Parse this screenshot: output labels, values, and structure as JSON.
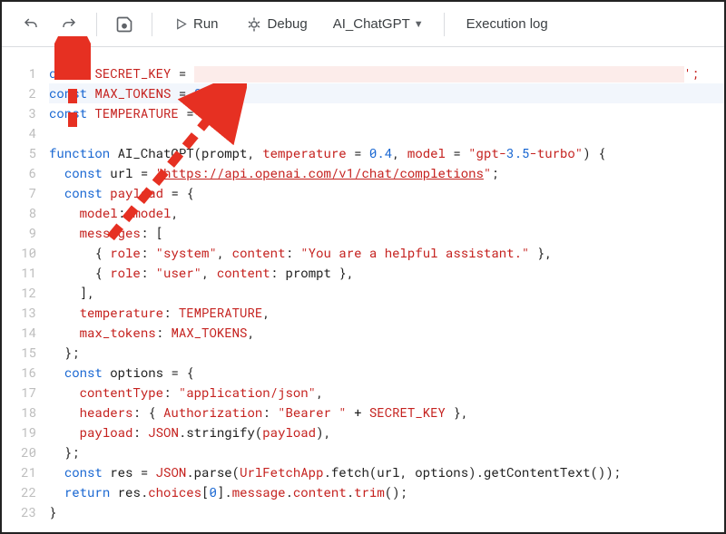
{
  "toolbar": {
    "undo_title": "Undo",
    "redo_title": "Redo",
    "save_title": "Save",
    "run_label": "Run",
    "debug_label": "Debug",
    "function_selected": "AI_ChatGPT",
    "execution_log_label": "Execution log"
  },
  "editor": {
    "current_line": 2,
    "lines": [
      "const SECRET_KEY = ",
      "const MAX_TOKENS = 800;",
      "const TEMPERATURE = 0.9;",
      "",
      "function AI_ChatGPT(prompt, temperature = 0.4, model = \"gpt-3.5-turbo\") {",
      "  const url = \"https://api.openai.com/v1/chat/completions\";",
      "  const payload = {",
      "    model: model,",
      "    messages: [",
      "      { role: \"system\", content: \"You are a helpful assistant.\" },",
      "      { role: \"user\", content: prompt },",
      "    ],",
      "    temperature: TEMPERATURE,",
      "    max_tokens: MAX_TOKENS,",
      "  };",
      "  const options = {",
      "    contentType: \"application/json\",",
      "    headers: { Authorization: \"Bearer \" + SECRET_KEY },",
      "    payload: JSON.stringify(payload),",
      "  };",
      "  const res = JSON.parse(UrlFetchApp.fetch(url, options).getContentText());",
      "  return res.choices[0].message.content.trim();",
      "}"
    ],
    "secret_redacted_trailing": "';",
    "annotation": "Two red arrows point to the Save button and to the value 0.9"
  }
}
